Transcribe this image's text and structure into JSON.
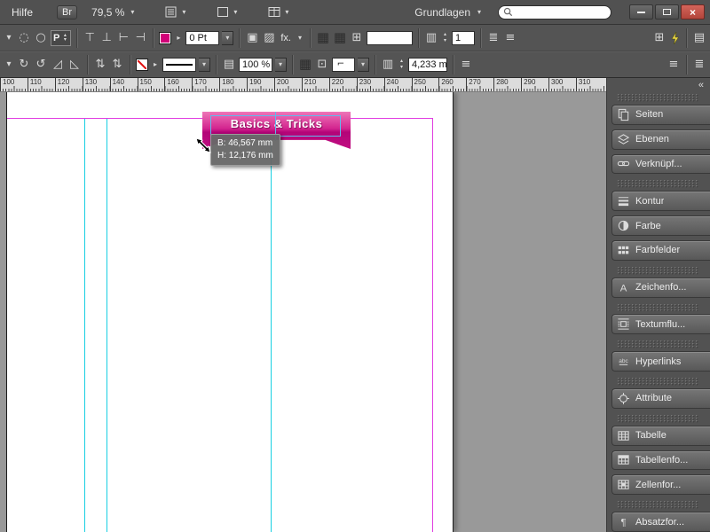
{
  "appbar": {
    "menu_hilfe": "Hilfe",
    "bridge_label": "Br",
    "zoom_value": "79,5 %",
    "workspace": "Grundlagen",
    "search_placeholder": ""
  },
  "controls": {
    "position_badge": "P",
    "stroke_weight": "0 Pt",
    "fx_label": "fx.",
    "opacity": "100 %",
    "columns_value": "1",
    "gutter_value": "4,233 m"
  },
  "icons": {
    "dropdown": "▾",
    "flyout": "▸",
    "spin_up": "▴",
    "spin_down": "▾",
    "circle_dashed": "◌",
    "circle": "○",
    "rotate_cw": "↻",
    "rotate_ccw": "↺",
    "shear_right": "◿",
    "shear_left": "◺",
    "align_top": "⊤",
    "align_bottom": "⊥",
    "align_left": "⊢",
    "align_right": "⊣",
    "updown": "⇅",
    "grid_dark": "▦",
    "grid_cols": "▥",
    "grid_rows": "▤",
    "square_shadow": "▣",
    "square_hatch": "▨",
    "frame_plus": "⊞",
    "frame_dot": "⊡",
    "menu_lines": "≡",
    "menu_lines_alt": "≣",
    "corner_option": "⌐",
    "collapse": "«",
    "close": "×",
    "letter_a": "A",
    "letters_abc": "abc",
    "pilcrow": "¶"
  },
  "ruler": {
    "unit_labels": [
      "100",
      "110",
      "120",
      "130",
      "140",
      "150",
      "160",
      "170",
      "180",
      "190",
      "200",
      "210",
      "220",
      "230",
      "240",
      "250",
      "260",
      "270",
      "280",
      "290",
      "300",
      "310"
    ]
  },
  "canvas": {
    "ribbon_text": "Basics & Tricks",
    "tooltip": {
      "width_label": "B: 46,567 mm",
      "height_label": "H: 12,176 mm"
    }
  },
  "dock": {
    "buttons": [
      {
        "label": "Seiten"
      },
      {
        "label": "Ebenen"
      },
      {
        "label": "Verknüpf..."
      },
      {
        "label": "Kontur"
      },
      {
        "label": "Farbe"
      },
      {
        "label": "Farbfelder"
      },
      {
        "label": "Zeichenfo..."
      },
      {
        "label": "Textumflu..."
      },
      {
        "label": "Hyperlinks"
      },
      {
        "label": "Attribute"
      },
      {
        "label": "Tabelle"
      },
      {
        "label": "Tabellenfo..."
      },
      {
        "label": "Zellenfor..."
      },
      {
        "label": "Absatzfor..."
      }
    ]
  }
}
